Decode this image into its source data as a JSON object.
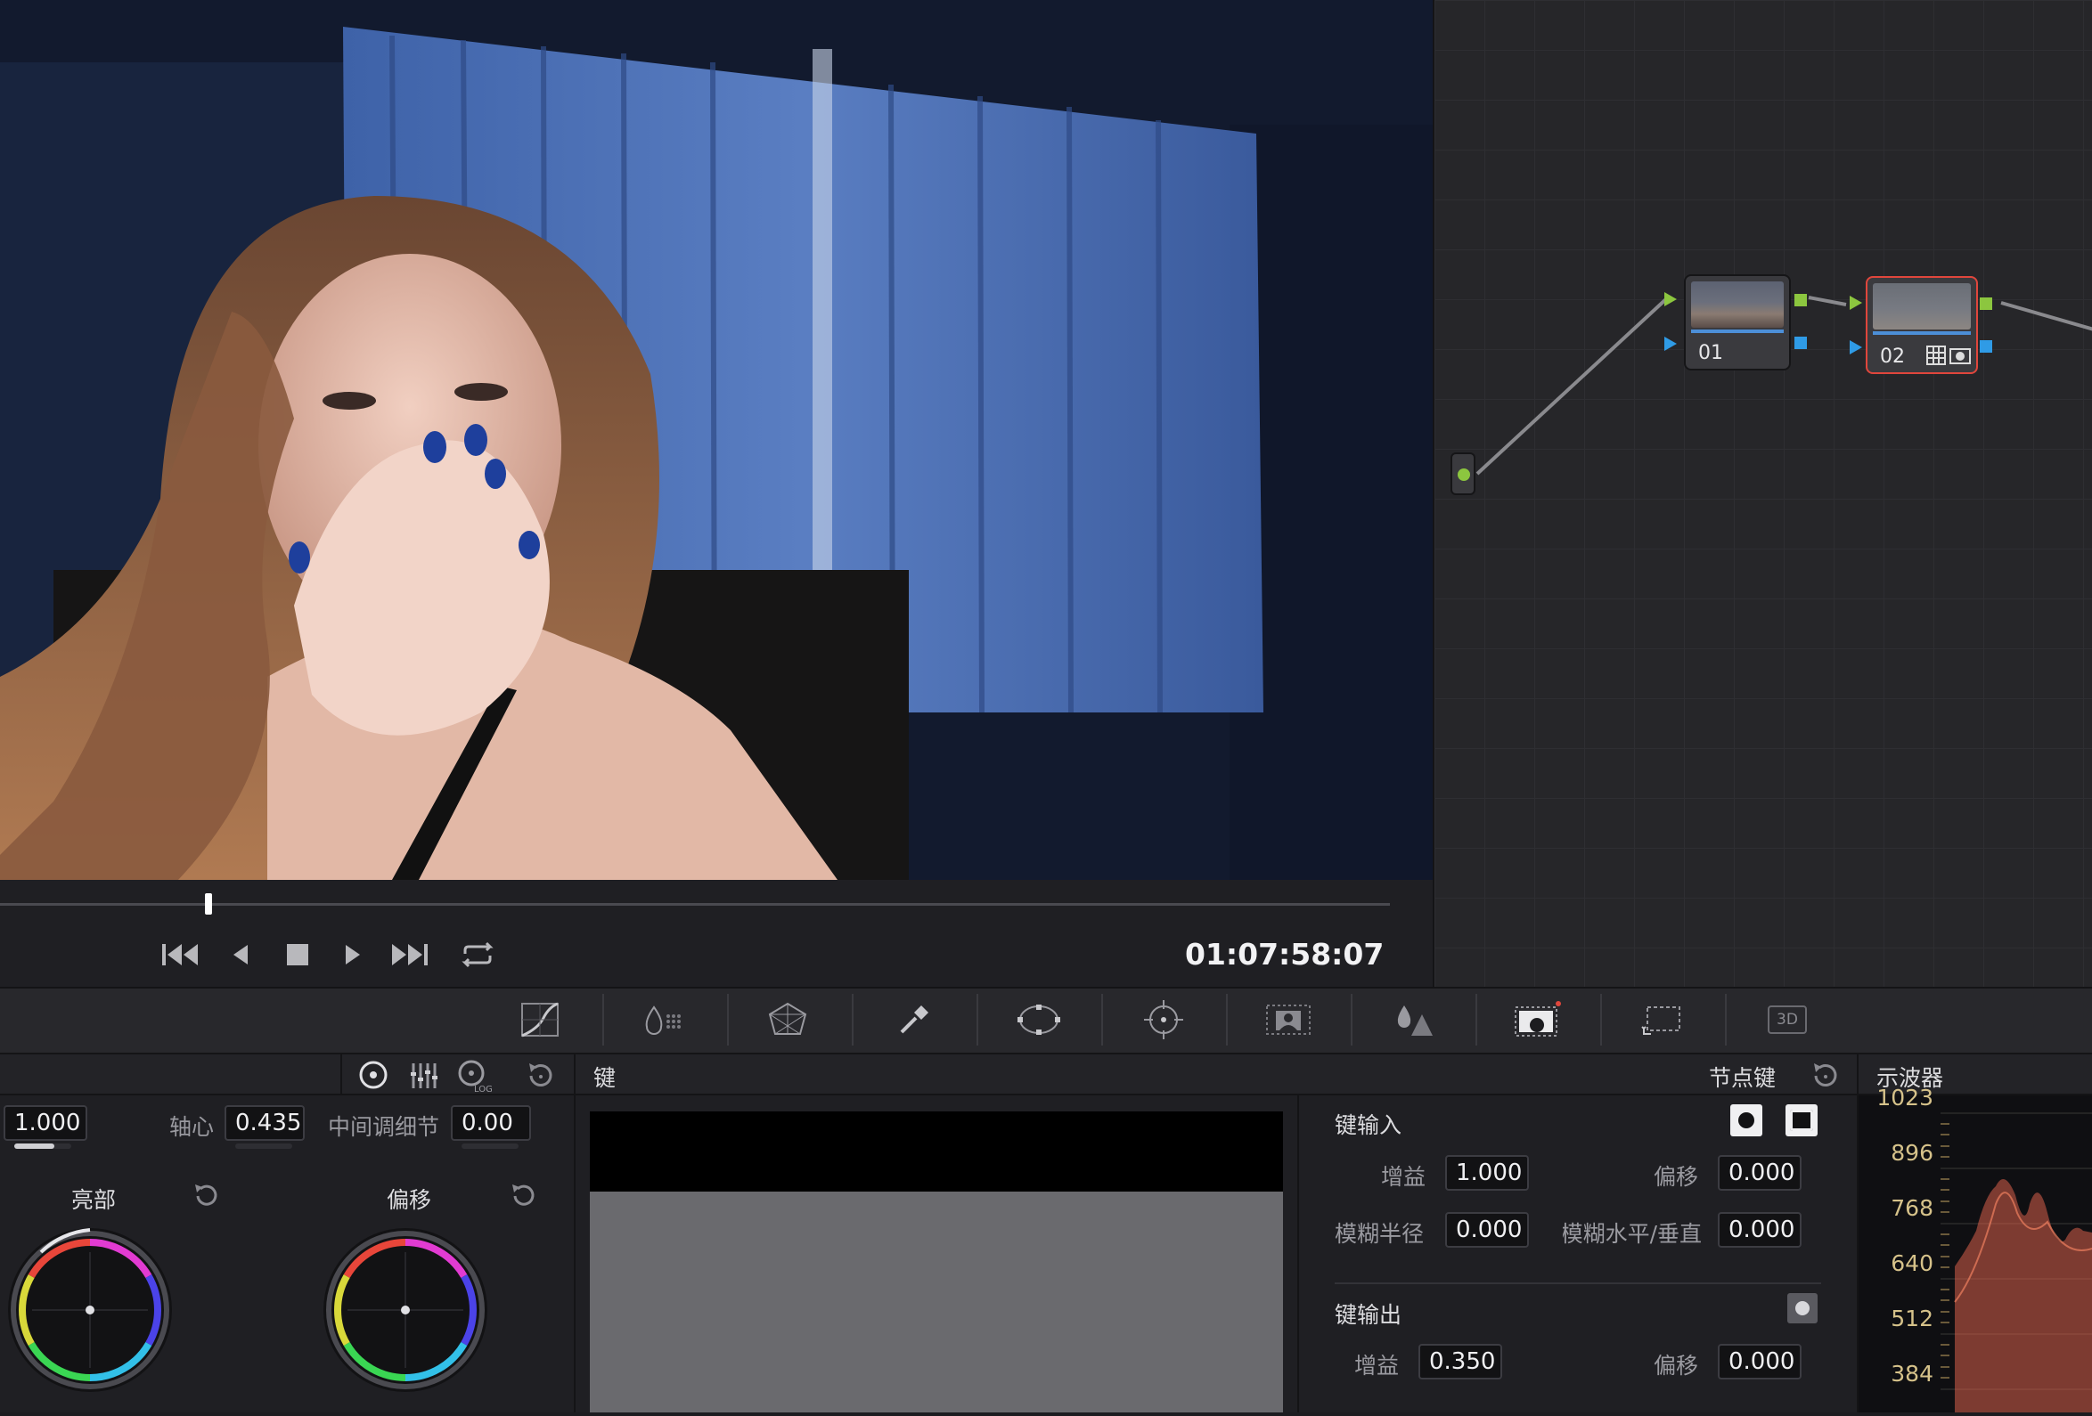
{
  "viewer": {
    "timecode": "01:07:58:07",
    "playhead_fraction": 0.15
  },
  "transport": {
    "icons": [
      "skip-to-start-icon",
      "step-back-icon",
      "stop-icon",
      "play-icon",
      "skip-to-end-icon",
      "loop-icon"
    ]
  },
  "node_editor": {
    "nodes": [
      {
        "label": "01"
      },
      {
        "label": "02"
      }
    ]
  },
  "toolbar": {
    "tools": [
      "curves-icon",
      "color-warper-icon",
      "color-warper-mesh-icon",
      "qualifier-icon",
      "window-icon",
      "tracker-icon",
      "magic-mask-icon",
      "blur-icon",
      "key-icon",
      "sizing-icon",
      "3d-icon"
    ],
    "three_d_label": "3D"
  },
  "primaries": {
    "gain_value": "1.000",
    "pivot_label": "轴心",
    "pivot_value": "0.435",
    "middetail_label": "中间调细节",
    "middetail_value": "0.00",
    "wheel_highlights_label": "亮部",
    "wheel_offset_label": "偏移"
  },
  "key_panel": {
    "title": "键",
    "node_key_label": "节点键",
    "key_input_label": "键输入",
    "gain_label": "增益",
    "gain_in_value": "1.000",
    "offset_label": "偏移",
    "offset_in_value": "0.000",
    "blur_radius_label": "模糊半径",
    "blur_radius_value": "0.000",
    "blur_hv_label": "模糊水平/垂直",
    "blur_hv_value": "0.000",
    "key_output_label": "键输出",
    "gain_out_value": "0.350",
    "offset_out_value": "0.000"
  },
  "scope": {
    "title": "示波器",
    "ticks": [
      "1023",
      "896",
      "768",
      "640",
      "512",
      "384"
    ]
  },
  "colors": {
    "accent_blue": "#4c8fd8",
    "node_selected": "#e0463c",
    "port_green": "#8cc63f",
    "port_blue": "#2f9be6",
    "scope_trace": "#d8604a"
  }
}
